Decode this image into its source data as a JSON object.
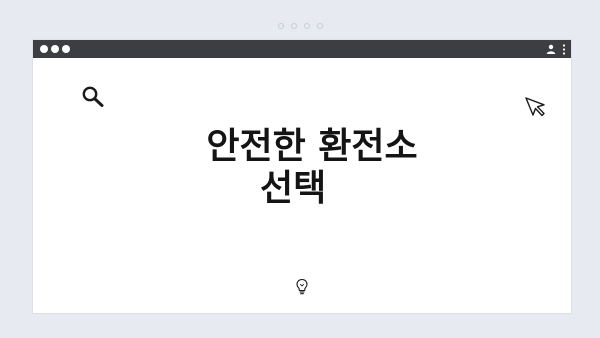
{
  "slide": {
    "headline_line1": "안전한 환전소",
    "headline_line2": "선택"
  },
  "icons": {
    "search": "search-icon",
    "cursor": "cursor-icon",
    "lightbulb": "lightbulb-icon",
    "user": "user-icon",
    "menu": "kebab-menu-icon"
  },
  "colors": {
    "background": "#e7ebf1",
    "titlebar": "#3d3e42",
    "text": "#141414"
  }
}
